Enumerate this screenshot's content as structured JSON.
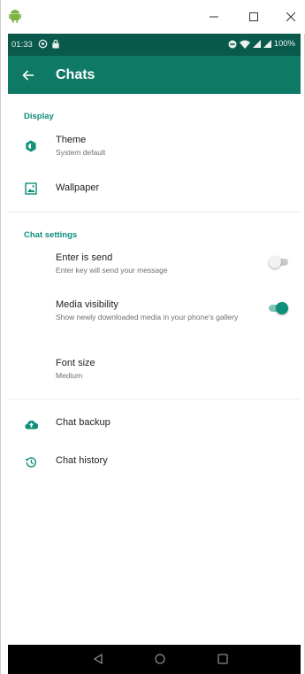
{
  "status_bar": {
    "time": "01:33",
    "battery": "100%"
  },
  "app_bar": {
    "title": "Chats"
  },
  "sections": {
    "display": {
      "header": "Display",
      "theme": {
        "label": "Theme",
        "value": "System default"
      },
      "wallpaper": {
        "label": "Wallpaper"
      }
    },
    "chat_settings": {
      "header": "Chat settings",
      "enter_is_send": {
        "label": "Enter is send",
        "description": "Enter key will send your message",
        "enabled": false
      },
      "media_visibility": {
        "label": "Media visibility",
        "description": "Show newly downloaded media in your phone's gallery",
        "enabled": true
      },
      "font_size": {
        "label": "Font size",
        "value": "Medium"
      }
    },
    "other": {
      "chat_backup": {
        "label": "Chat backup"
      },
      "chat_history": {
        "label": "Chat history"
      }
    }
  },
  "colors": {
    "status_bar": "#0a5a4c",
    "app_bar": "#0e7a66",
    "accent": "#0d8f7a",
    "toggle_on_track": "#7fc4b8",
    "toggle_off_track": "#c9c9c9"
  },
  "icons": {
    "window": [
      "android-icon",
      "minimize-icon",
      "maximize-icon",
      "close-icon"
    ],
    "status": [
      "whatsapp-status-icon",
      "lock-icon",
      "dnd-icon",
      "wifi-icon",
      "signal-icon",
      "battery-icon"
    ],
    "settings": [
      "theme-icon",
      "wallpaper-icon",
      "cloud-upload-icon",
      "history-icon"
    ],
    "nav": [
      "back-triangle-icon",
      "home-circle-icon",
      "recents-square-icon"
    ]
  }
}
